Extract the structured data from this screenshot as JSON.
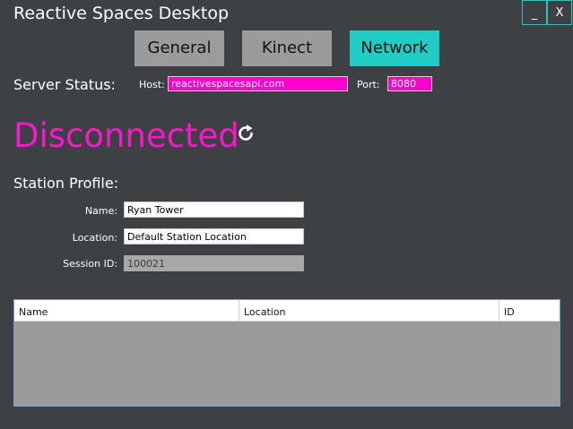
{
  "window": {
    "title": "Reactive Spaces Desktop",
    "minimize_label": "_",
    "close_label": "X"
  },
  "tabs": [
    {
      "label": "General",
      "active": false
    },
    {
      "label": "Kinect",
      "active": false
    },
    {
      "label": "Network",
      "active": true
    }
  ],
  "server": {
    "status_label": "Server Status:",
    "host_label": "Host:",
    "host_value": "reactivespacesapi.com",
    "port_label": "Port:",
    "port_value": "8080",
    "connection_status": "Disconnected",
    "refresh_icon": "refresh-icon"
  },
  "station": {
    "section_label": "Station Profile:",
    "name_label": "Name:",
    "name_value": "Ryan Tower",
    "location_label": "Location:",
    "location_value": "Default Station Location",
    "session_label": "Session ID:",
    "session_value": "100021"
  },
  "grid": {
    "columns": [
      "Name",
      "Location",
      "ID"
    ],
    "rows": []
  },
  "colors": {
    "background": "#3d4143",
    "accent": "#1fcdc4",
    "tab_inactive": "#9b9b9b",
    "status_disconnected": "#ff14cf",
    "input_magenta": "#ff00cc"
  }
}
